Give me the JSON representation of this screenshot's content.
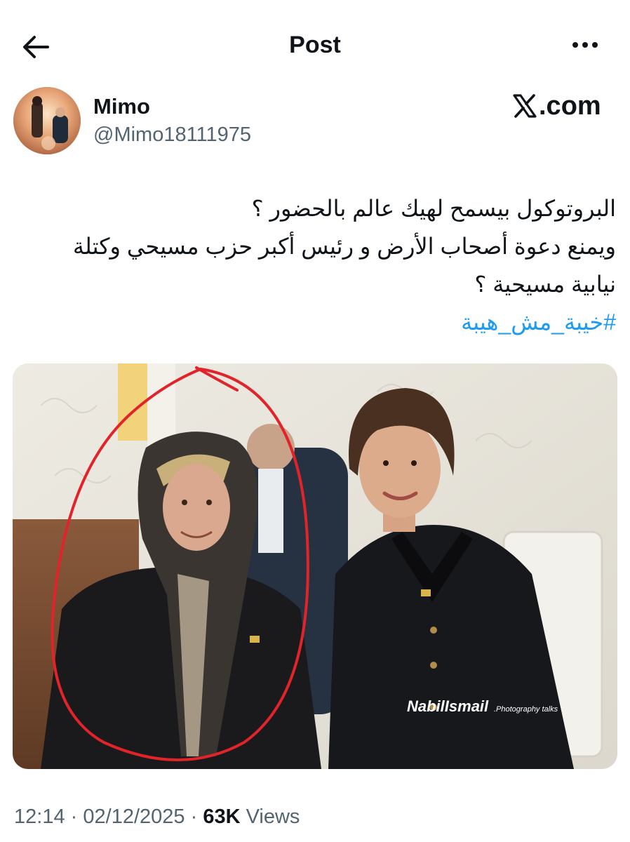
{
  "header": {
    "title": "Post",
    "back_icon": "arrow-left-icon",
    "more_icon": "more-horizontal-icon"
  },
  "author": {
    "display_name": "Mimo",
    "handle": "@Mimo18111975"
  },
  "brand": {
    "label": ".com",
    "icon": "x-logo-icon"
  },
  "tweet": {
    "lines": [
      "البروتوكول بيسمح لهيك عالم بالحضور ؟",
      "ويمنع دعوة أصحاب الأرض و رئيس أكبر حزب مسيحي وكتلة",
      "نيابية مسيحية ؟"
    ],
    "hashtag": "#خيبة_مش_هيبة"
  },
  "photo": {
    "watermark_main": "NabilIsmail",
    "watermark_sub": ".Photography talks"
  },
  "meta": {
    "time": "12:14",
    "date": "02/12/2025",
    "views_count": "63K",
    "views_label": "Views",
    "separator": "·"
  },
  "colors": {
    "text": "#0f1419",
    "secondary": "#536471",
    "link": "#1d9bf0",
    "annotation_circle": "#e0242a"
  }
}
